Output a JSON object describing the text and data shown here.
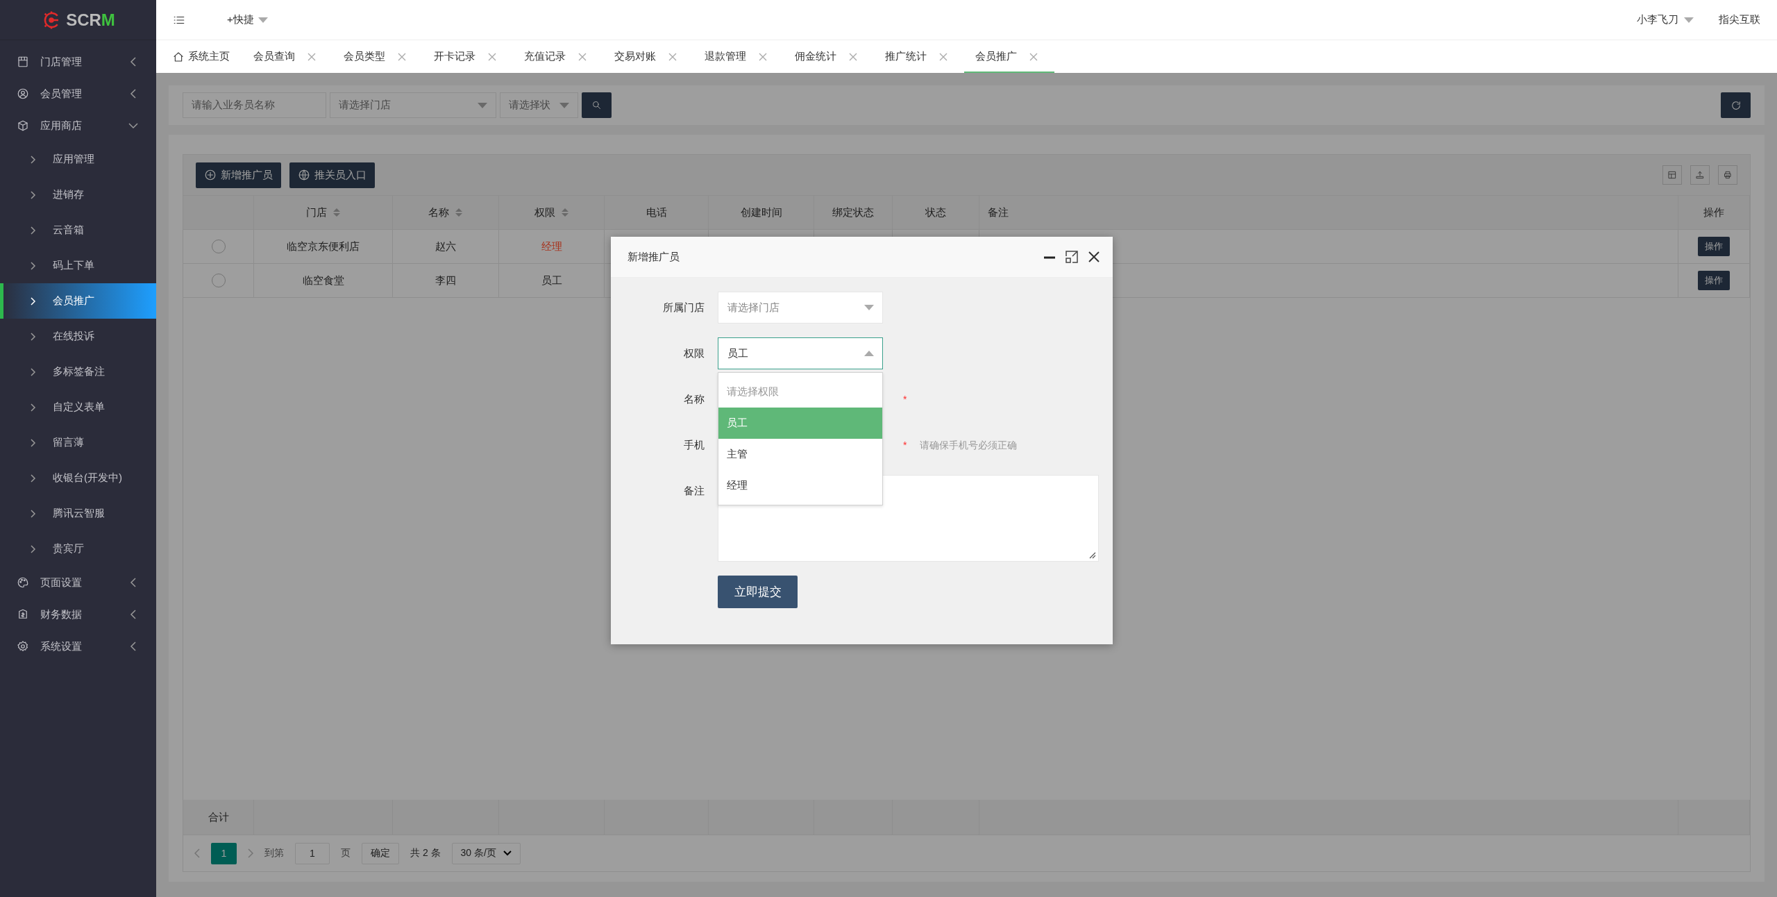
{
  "logo": {
    "text": "SCR",
    "accent": "M"
  },
  "sidebar": {
    "items": [
      {
        "label": "门店管理",
        "expanded": false
      },
      {
        "label": "会员管理",
        "expanded": false
      },
      {
        "label": "应用商店",
        "expanded": true,
        "children": [
          {
            "label": "应用管理",
            "selected": false
          },
          {
            "label": "进销存",
            "selected": false
          },
          {
            "label": "云音箱",
            "selected": false
          },
          {
            "label": "码上下单",
            "selected": false
          },
          {
            "label": "会员推广",
            "selected": true
          },
          {
            "label": "在线投诉",
            "selected": false
          },
          {
            "label": "多标签备注",
            "selected": false
          },
          {
            "label": "自定义表单",
            "selected": false
          },
          {
            "label": "留言薄",
            "selected": false
          },
          {
            "label": "收银台(开发中)",
            "selected": false
          },
          {
            "label": "腾讯云智服",
            "selected": false
          },
          {
            "label": "贵宾厅",
            "selected": false
          }
        ]
      },
      {
        "label": "页面设置",
        "expanded": false
      },
      {
        "label": "财务数据",
        "expanded": false
      },
      {
        "label": "系统设置",
        "expanded": false
      }
    ]
  },
  "topbar": {
    "quick": "+快捷",
    "user": "小李飞刀",
    "company": "指尖互联"
  },
  "tabs": [
    {
      "kind": "home",
      "label": "系统主页",
      "selected": false
    },
    {
      "kind": "page",
      "label": "会员查询",
      "selected": false
    },
    {
      "kind": "page",
      "label": "会员类型",
      "selected": false
    },
    {
      "kind": "page",
      "label": "开卡记录",
      "selected": false
    },
    {
      "kind": "page",
      "label": "充值记录",
      "selected": false
    },
    {
      "kind": "page",
      "label": "交易对账",
      "selected": false
    },
    {
      "kind": "page",
      "label": "退款管理",
      "selected": false
    },
    {
      "kind": "page",
      "label": "佣金统计",
      "selected": false
    },
    {
      "kind": "page",
      "label": "推广统计",
      "selected": false
    },
    {
      "kind": "page",
      "label": "会员推广",
      "selected": true
    }
  ],
  "search": {
    "name_placeholder": "请输入业务员名称",
    "store_placeholder": "请选择门店",
    "status_placeholder": "请选择状"
  },
  "toolbar": {
    "buttons": [
      {
        "kind": "add",
        "label": "新增推广员"
      },
      {
        "kind": "globe",
        "label": "推关员入口"
      }
    ]
  },
  "table": {
    "columns": [
      {
        "label": "门店",
        "sortable": true
      },
      {
        "label": "名称",
        "sortable": true
      },
      {
        "label": "权限",
        "sortable": true
      },
      {
        "label": "电话",
        "sortable": false
      },
      {
        "label": "创建时间",
        "sortable": false
      },
      {
        "label": "绑定状态",
        "sortable": false
      },
      {
        "label": "状态",
        "sortable": false
      },
      {
        "label": "备注",
        "sortable": false
      },
      {
        "label": "操作",
        "sortable": false
      }
    ],
    "rows": [
      {
        "selected": false,
        "store": "临空京东便利店",
        "name": "赵六",
        "role": "经理",
        "color": "#a8321c",
        "action": "操作"
      },
      {
        "selected": false,
        "store": "临空食堂",
        "name": "李四",
        "role": "员工",
        "color": "#222222",
        "action": "操作"
      }
    ],
    "total_label": "合计"
  },
  "pagination": {
    "pages": [
      {
        "label": "1",
        "selected": true
      }
    ],
    "goto": "到第",
    "page_input": "1",
    "page_unit": "页",
    "confirm": "确定",
    "total": "共 2 条",
    "page_size": "30 条/页"
  },
  "modal": {
    "title": "新增推广员",
    "fields": [
      {
        "kind": "select",
        "label": "所属门店",
        "placeholder": "请选择门店",
        "open": false
      },
      {
        "kind": "select",
        "label": "权限",
        "value": "员工",
        "open": true,
        "options": [
          {
            "kind": "placeholder",
            "label": "请选择权限",
            "selected": false
          },
          {
            "kind": "option",
            "label": "员工",
            "selected": true
          },
          {
            "kind": "option",
            "label": "主管",
            "selected": false
          },
          {
            "kind": "option",
            "label": "经理",
            "selected": false
          }
        ]
      },
      {
        "kind": "input",
        "label": "名称",
        "mark": "*"
      },
      {
        "kind": "input",
        "label": "手机",
        "mark": "*",
        "hint": "请确保手机号必须正确"
      },
      {
        "kind": "textarea",
        "label": "备注"
      }
    ],
    "submit": "立即提交"
  }
}
